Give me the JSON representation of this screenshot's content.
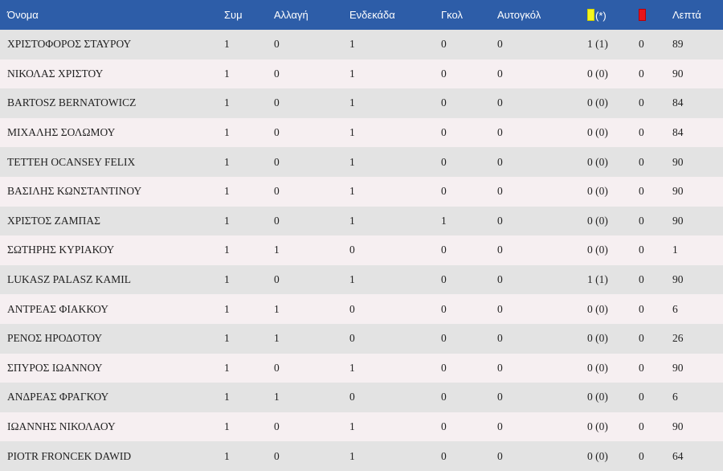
{
  "header": {
    "name": "Όνομα",
    "apps": "Συμ",
    "sub": "Αλλαγή",
    "xi": "Ενδεκάδα",
    "goals": "Γκολ",
    "own_goals": "Αυτογκόλ",
    "yellow_suffix": "(*)",
    "yellow_icon": "yellow-card-icon",
    "red_icon": "red-card-icon",
    "minutes": "Λεπτά"
  },
  "colors": {
    "header_bg": "#2d5da8",
    "row_odd": "#e3e3e3",
    "row_even": "#f6eff1",
    "yellow": "#f5f51e",
    "red": "#e8141b"
  },
  "rows": [
    {
      "name": "ΧΡΙΣΤΟΦΟΡΟΣ ΣΤΑΥΡΟΥ",
      "apps": "1",
      "sub": "0",
      "xi": "1",
      "goals": "0",
      "own_goals": "0",
      "yellow": "1 (1)",
      "red": "0",
      "minutes": "89"
    },
    {
      "name": "ΝΙΚΟΛΑΣ ΧΡΙΣΤΟΥ",
      "apps": "1",
      "sub": "0",
      "xi": "1",
      "goals": "0",
      "own_goals": "0",
      "yellow": "0 (0)",
      "red": "0",
      "minutes": "90"
    },
    {
      "name": "BARTOSZ BERNATOWICZ",
      "apps": "1",
      "sub": "0",
      "xi": "1",
      "goals": "0",
      "own_goals": "0",
      "yellow": "0 (0)",
      "red": "0",
      "minutes": "84"
    },
    {
      "name": "ΜΙΧΑΛΗΣ ΣΟΛΩΜΟΥ",
      "apps": "1",
      "sub": "0",
      "xi": "1",
      "goals": "0",
      "own_goals": "0",
      "yellow": "0 (0)",
      "red": "0",
      "minutes": "84"
    },
    {
      "name": "TETTEH OCANSEY FELIX",
      "apps": "1",
      "sub": "0",
      "xi": "1",
      "goals": "0",
      "own_goals": "0",
      "yellow": "0 (0)",
      "red": "0",
      "minutes": "90"
    },
    {
      "name": "ΒΑΣΙΛΗΣ ΚΩΝΣΤΑΝΤΙΝΟΥ",
      "apps": "1",
      "sub": "0",
      "xi": "1",
      "goals": "0",
      "own_goals": "0",
      "yellow": "0 (0)",
      "red": "0",
      "minutes": "90"
    },
    {
      "name": "ΧΡΙΣΤΟΣ ΖΑΜΠΑΣ",
      "apps": "1",
      "sub": "0",
      "xi": "1",
      "goals": "1",
      "own_goals": "0",
      "yellow": "0 (0)",
      "red": "0",
      "minutes": "90"
    },
    {
      "name": "ΣΩΤΗΡΗΣ ΚΥΡΙΑΚΟΥ",
      "apps": "1",
      "sub": "1",
      "xi": "0",
      "goals": "0",
      "own_goals": "0",
      "yellow": "0 (0)",
      "red": "0",
      "minutes": "1"
    },
    {
      "name": "LUKASZ PALASZ KAMIL",
      "apps": "1",
      "sub": "0",
      "xi": "1",
      "goals": "0",
      "own_goals": "0",
      "yellow": "1 (1)",
      "red": "0",
      "minutes": "90"
    },
    {
      "name": "ΑΝΤΡΕΑΣ ΦΙΑΚΚΟΥ",
      "apps": "1",
      "sub": "1",
      "xi": "0",
      "goals": "0",
      "own_goals": "0",
      "yellow": "0 (0)",
      "red": "0",
      "minutes": "6"
    },
    {
      "name": "ΡΕΝΟΣ ΗΡΟΔΟΤΟΥ",
      "apps": "1",
      "sub": "1",
      "xi": "0",
      "goals": "0",
      "own_goals": "0",
      "yellow": "0 (0)",
      "red": "0",
      "minutes": "26"
    },
    {
      "name": "ΣΠΥΡΟΣ ΙΩΑΝΝΟΥ",
      "apps": "1",
      "sub": "0",
      "xi": "1",
      "goals": "0",
      "own_goals": "0",
      "yellow": "0 (0)",
      "red": "0",
      "minutes": "90"
    },
    {
      "name": "ΑΝΔΡΕΑΣ ΦΡΑΓΚΟΥ",
      "apps": "1",
      "sub": "1",
      "xi": "0",
      "goals": "0",
      "own_goals": "0",
      "yellow": "0 (0)",
      "red": "0",
      "minutes": "6"
    },
    {
      "name": "ΙΩΑΝΝΗΣ ΝΙΚΟΛΑΟΥ",
      "apps": "1",
      "sub": "0",
      "xi": "1",
      "goals": "0",
      "own_goals": "0",
      "yellow": "0 (0)",
      "red": "0",
      "minutes": "90"
    },
    {
      "name": "PIOTR FRONCEK DAWID",
      "apps": "1",
      "sub": "0",
      "xi": "1",
      "goals": "0",
      "own_goals": "0",
      "yellow": "0 (0)",
      "red": "0",
      "minutes": "64"
    }
  ]
}
